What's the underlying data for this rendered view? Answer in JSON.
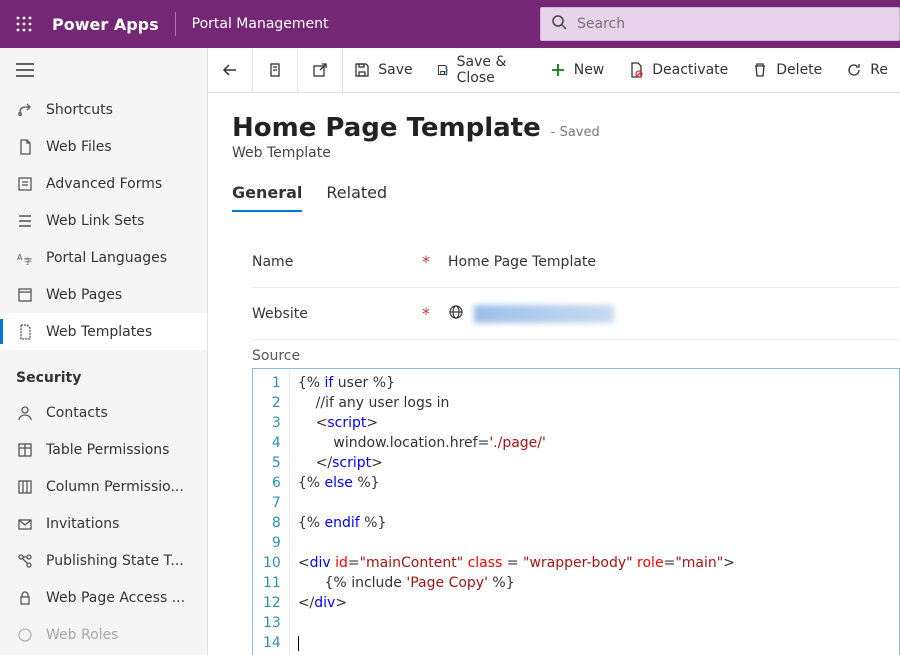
{
  "header": {
    "brand": "Power Apps",
    "subtitle": "Portal Management",
    "search_placeholder": "Search"
  },
  "nav": {
    "items": [
      {
        "label": "Shortcuts",
        "icon": "shortcut"
      },
      {
        "label": "Web Files",
        "icon": "webfile"
      },
      {
        "label": "Advanced Forms",
        "icon": "form"
      },
      {
        "label": "Web Link Sets",
        "icon": "linkset"
      },
      {
        "label": "Portal Languages",
        "icon": "language"
      },
      {
        "label": "Web Pages",
        "icon": "webpage"
      },
      {
        "label": "Web Templates",
        "icon": "template",
        "active": true
      }
    ],
    "group2_title": "Security",
    "items2": [
      {
        "label": "Contacts",
        "icon": "contact"
      },
      {
        "label": "Table Permissions",
        "icon": "tableperm"
      },
      {
        "label": "Column Permissio...",
        "icon": "colperm"
      },
      {
        "label": "Invitations",
        "icon": "invite"
      },
      {
        "label": "Publishing State T...",
        "icon": "publish"
      },
      {
        "label": "Web Page Access ...",
        "icon": "access"
      },
      {
        "label": "Web Roles",
        "icon": "roles"
      }
    ]
  },
  "toolbar": {
    "save": "Save",
    "save_close": "Save & Close",
    "new": "New",
    "deactivate": "Deactivate",
    "delete": "Delete",
    "refresh": "Re"
  },
  "page": {
    "title": "Home Page Template",
    "state": "- Saved",
    "subtype": "Web Template",
    "tabs": [
      {
        "label": "General",
        "active": true
      },
      {
        "label": "Related"
      }
    ],
    "fields": {
      "name_label": "Name",
      "name_value": "Home Page Template",
      "website_label": "Website",
      "source_label": "Source"
    },
    "source_code": {
      "1": "{% if user %}",
      "2": "    //if any user logs in",
      "3": "    <script>",
      "4": "        window.location.href='./page/'",
      "5": "    </script>",
      "6": "{% else %}",
      "7": "",
      "8": "{% endif %}",
      "9": "",
      "10": "<div id=\"mainContent\" class = \"wrapper-body\" role=\"main\">",
      "11": "      {% include 'Page Copy' %}",
      "12": "</div>",
      "13": "",
      "14": ""
    }
  }
}
